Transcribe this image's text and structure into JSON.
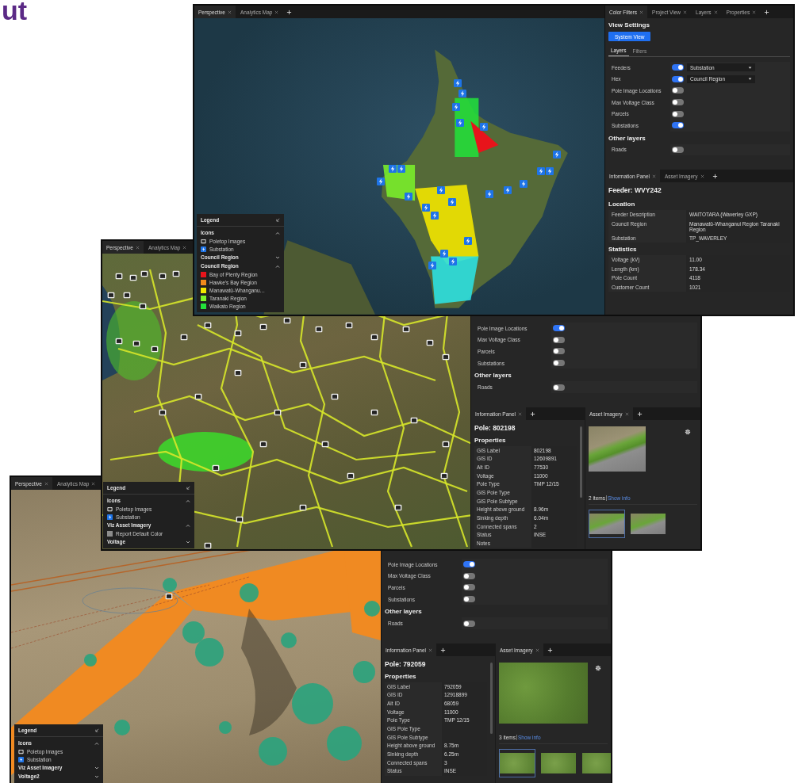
{
  "heading": "ut",
  "windows": [
    {
      "map_tabs": [
        {
          "label": "Perspective",
          "selected": true
        },
        {
          "label": "Analytics Map",
          "selected": false
        }
      ],
      "legend": {
        "title": "Legend",
        "sections": [
          {
            "heading": "Icons",
            "expanded": true,
            "items": [
              {
                "kind": "poletop",
                "label": "Poletop Images"
              },
              {
                "kind": "substation",
                "label": "Substation"
              }
            ]
          },
          {
            "heading": "Council Region",
            "expanded": false
          },
          {
            "heading": "Council Region",
            "expanded": true,
            "items": [
              {
                "kind": "swatch",
                "label": "Bay of Plenty Region",
                "color": "#e8141b"
              },
              {
                "kind": "swatch",
                "label": "Hawke's Bay Region",
                "color": "#f08a1c"
              },
              {
                "kind": "swatch",
                "label": "Manawatū-Whanganu…",
                "color": "#f2e600"
              },
              {
                "kind": "swatch",
                "label": "Taranaki Region",
                "color": "#7cf52a"
              },
              {
                "kind": "swatch",
                "label": "Waikato Region",
                "color": "#22e33a"
              }
            ]
          }
        ]
      },
      "panel_tabs": [
        {
          "label": "Color Filters",
          "selected": true
        },
        {
          "label": "Project View",
          "selected": false
        },
        {
          "label": "Layers",
          "selected": false
        },
        {
          "label": "Properties",
          "selected": false
        }
      ],
      "view_settings": {
        "title": "View Settings",
        "button": "System View",
        "tabs": [
          {
            "label": "Layers",
            "selected": true
          },
          {
            "label": "Filters",
            "selected": false
          }
        ]
      },
      "layers": [
        {
          "label": "Feeders",
          "on": true,
          "dropdown": "Substation"
        },
        {
          "label": "Hex",
          "on": true,
          "dropdown": "Council Region"
        },
        {
          "label": "Pole Image Locations",
          "on": false
        },
        {
          "label": "Max Voltage Class",
          "on": false
        },
        {
          "label": "Parcels",
          "on": false
        },
        {
          "label": "Substations",
          "on": true
        }
      ],
      "other_layers": {
        "heading": "Other layers",
        "items": [
          {
            "label": "Roads",
            "on": false
          }
        ]
      },
      "info_tabs": [
        {
          "label": "Information Panel",
          "selected": true
        },
        {
          "label": "Asset Imagery",
          "selected": false
        }
      ],
      "info": {
        "title": "Feeder: WVY242",
        "sections": [
          {
            "heading": "Location",
            "rows": [
              {
                "label": "Feeder Description",
                "value": "WAITOTARA (Waverley GXP)"
              },
              {
                "label": "Council Region",
                "value": "Manawatū-Whanganui Region Taranaki Region"
              },
              {
                "label": "Substation",
                "value": "TP_WAVERLEY"
              }
            ]
          },
          {
            "heading": "Statistics",
            "rows": [
              {
                "label": "Voltage (kV)",
                "value": "11.00"
              },
              {
                "label": "Length (km)",
                "value": "178.34"
              },
              {
                "label": "Pole Count",
                "value": "4118"
              },
              {
                "label": "Customer Count",
                "value": "1021"
              }
            ]
          }
        ]
      }
    },
    {
      "map_tabs": [
        {
          "label": "Perspective",
          "selected": true
        },
        {
          "label": "Analytics Map",
          "selected": false
        }
      ],
      "legend": {
        "title": "Legend",
        "sections": [
          {
            "heading": "Icons",
            "expanded": true,
            "items": [
              {
                "kind": "poletop",
                "label": "Poletop Images"
              },
              {
                "kind": "substation",
                "label": "Substation"
              }
            ]
          },
          {
            "heading": "Viz Asset Imagery",
            "expanded": true,
            "items": [
              {
                "kind": "swatch",
                "label": "Report Default Color",
                "color": "#8c8c8c"
              }
            ]
          },
          {
            "heading": "Voltage",
            "expanded": false
          }
        ]
      },
      "layers": [
        {
          "label": "Pole Image Locations",
          "on": true
        },
        {
          "label": "Max Voltage Class",
          "on": false
        },
        {
          "label": "Parcels",
          "on": false
        },
        {
          "label": "Substations",
          "on": false
        }
      ],
      "other_layers": {
        "heading": "Other layers",
        "items": [
          {
            "label": "Roads",
            "on": false
          }
        ]
      },
      "info_tabs": [
        {
          "label": "Information Panel",
          "selected": true
        }
      ],
      "asset_tabs": [
        {
          "label": "Asset Imagery",
          "selected": true
        }
      ],
      "info": {
        "title": "Pole: 802198",
        "sections": [
          {
            "heading": "Properties",
            "rows": [
              {
                "label": "GIS Label",
                "value": "802198"
              },
              {
                "label": "GIS ID",
                "value": "12609891"
              },
              {
                "label": "Alt ID",
                "value": "77530"
              },
              {
                "label": "Voltage",
                "value": "11000"
              },
              {
                "label": "Pole Type",
                "value": "TMP 12/15"
              },
              {
                "label": "GIS Pole Type"
              },
              {
                "label": "GIS Pole Subtype"
              },
              {
                "label": "Height above ground",
                "value": "8.96m"
              },
              {
                "label": "Sinking depth",
                "value": "6.04m"
              },
              {
                "label": "Connected spans",
                "value": "2"
              },
              {
                "label": "Status",
                "value": "INSE"
              },
              {
                "label": "Notes"
              }
            ]
          }
        ]
      },
      "imagery": {
        "count": "2 items",
        "link": "Show info",
        "thumbnails": [
          {
            "selected": true
          },
          {
            "selected": false
          }
        ]
      }
    },
    {
      "map_tabs": [
        {
          "label": "Perspective",
          "selected": true
        },
        {
          "label": "Analytics Map",
          "selected": false
        }
      ],
      "legend": {
        "title": "Legend",
        "sections": [
          {
            "heading": "Icons",
            "expanded": true,
            "items": [
              {
                "kind": "poletop",
                "label": "Poletop Images"
              },
              {
                "kind": "substation",
                "label": "Substation"
              }
            ]
          },
          {
            "heading": "Viz Asset Imagery",
            "expanded": false
          },
          {
            "heading": "Voltage2",
            "expanded": false
          }
        ]
      },
      "layers": [
        {
          "label": "Pole Image Locations",
          "on": true
        },
        {
          "label": "Max Voltage Class",
          "on": false
        },
        {
          "label": "Parcels",
          "on": false
        },
        {
          "label": "Substations",
          "on": false
        }
      ],
      "other_layers": {
        "heading": "Other layers",
        "items": [
          {
            "label": "Roads",
            "on": false
          }
        ]
      },
      "info_tabs": [
        {
          "label": "Information Panel",
          "selected": true
        }
      ],
      "asset_tabs": [
        {
          "label": "Asset Imagery",
          "selected": true
        }
      ],
      "info": {
        "title": "Pole: 792059",
        "sections": [
          {
            "heading": "Properties",
            "rows": [
              {
                "label": "GIS Label",
                "value": "792059"
              },
              {
                "label": "GIS ID",
                "value": "12918899"
              },
              {
                "label": "Alt ID",
                "value": "68059"
              },
              {
                "label": "Voltage",
                "value": "11000"
              },
              {
                "label": "Pole Type",
                "value": "TMP 12/15"
              },
              {
                "label": "GIS Pole Type"
              },
              {
                "label": "GIS Pole Subtype"
              },
              {
                "label": "Height above ground",
                "value": "8.75m"
              },
              {
                "label": "Sinking depth",
                "value": "6.25m"
              },
              {
                "label": "Connected spans",
                "value": "3"
              },
              {
                "label": "Status",
                "value": "INSE"
              }
            ]
          }
        ]
      },
      "imagery": {
        "count": "3 items",
        "link": "Show info",
        "thumbnails": [
          {
            "selected": true
          },
          {
            "selected": false
          },
          {
            "selected": false
          }
        ]
      }
    }
  ]
}
